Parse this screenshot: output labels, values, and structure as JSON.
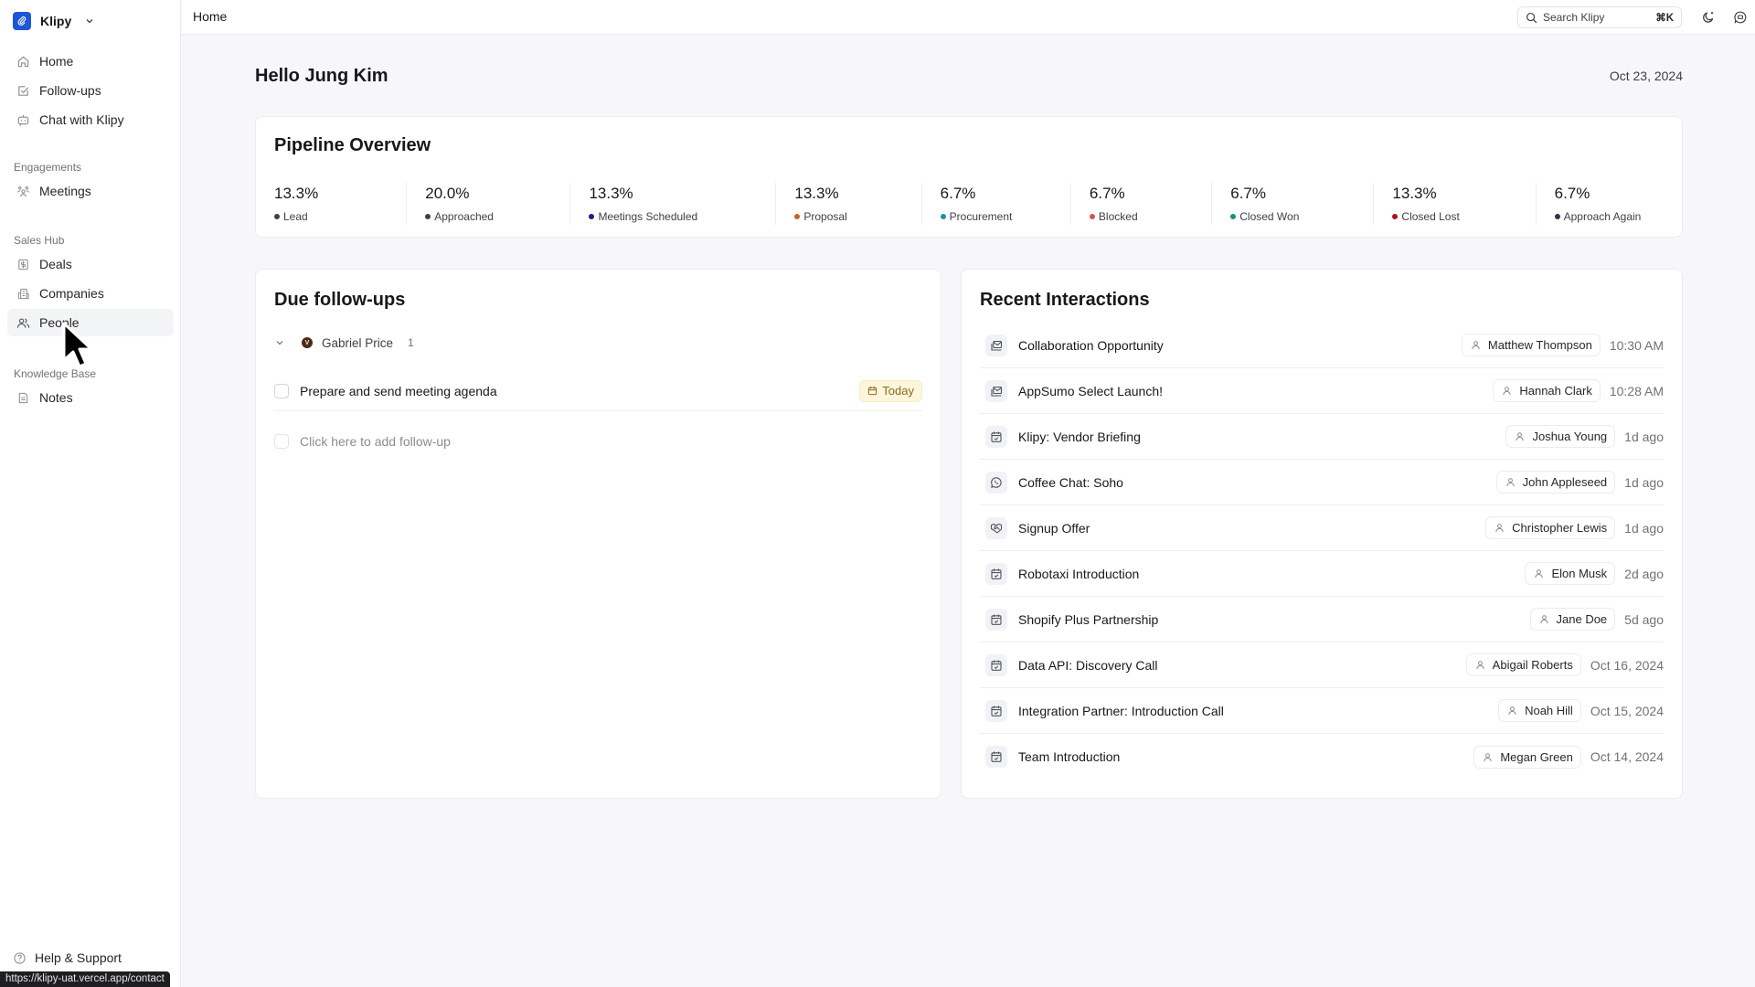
{
  "sidebar": {
    "brand": "Klipy",
    "top_items": [
      {
        "label": "Home",
        "icon": "home-icon"
      },
      {
        "label": "Follow-ups",
        "icon": "checkbox-icon"
      },
      {
        "label": "Chat with Klipy",
        "icon": "bot-icon"
      }
    ],
    "sections": [
      {
        "label": "Engagements",
        "items": [
          {
            "label": "Meetings",
            "icon": "users-group-icon"
          }
        ]
      },
      {
        "label": "Sales Hub",
        "items": [
          {
            "label": "Deals",
            "icon": "dollar-icon"
          },
          {
            "label": "Companies",
            "icon": "building-icon"
          },
          {
            "label": "People",
            "icon": "people-icon",
            "active": true
          }
        ]
      },
      {
        "label": "Knowledge Base",
        "items": [
          {
            "label": "Notes",
            "icon": "note-icon"
          }
        ]
      }
    ],
    "help": "Help & Support"
  },
  "status_url": "https://klipy-uat.vercel.app/contact",
  "topbar": {
    "title": "Home",
    "search_placeholder": "Search Klipy",
    "search_shortcut": "⌘K"
  },
  "main": {
    "greeting": "Hello Jung Kim",
    "date": "Oct 23, 2024",
    "pipeline": {
      "title": "Pipeline Overview",
      "stages": [
        {
          "pct": "13.3%",
          "label": "Lead",
          "color": "#3f3f46"
        },
        {
          "pct": "20.0%",
          "label": "Approached",
          "color": "#3f3f46"
        },
        {
          "pct": "13.3%",
          "label": "Meetings Scheduled",
          "color": "#1e1b8a"
        },
        {
          "pct": "13.3%",
          "label": "Proposal",
          "color": "#c2661f"
        },
        {
          "pct": "6.7%",
          "label": "Procurement",
          "color": "#1a8fa6"
        },
        {
          "pct": "6.7%",
          "label": "Blocked",
          "color": "#d0574b"
        },
        {
          "pct": "6.7%",
          "label": "Closed Won",
          "color": "#17936b"
        },
        {
          "pct": "13.3%",
          "label": "Closed Lost",
          "color": "#b0121f"
        },
        {
          "pct": "6.7%",
          "label": "Approach Again",
          "color": "#2f3447"
        }
      ]
    },
    "followups": {
      "title": "Due follow-ups",
      "group": {
        "name": "Gabriel Price",
        "count": "1",
        "initial": "V"
      },
      "tasks": [
        {
          "text": "Prepare and send meeting agenda",
          "due": "Today"
        }
      ],
      "add_placeholder": "Click here to add follow-up"
    },
    "recent": {
      "title": "Recent Interactions",
      "items": [
        {
          "title": "Collaboration Opportunity",
          "type": "email",
          "person": "Matthew Thompson",
          "time": "10:30 AM"
        },
        {
          "title": "AppSumo Select Launch!",
          "type": "email",
          "person": "Hannah Clark",
          "time": "10:28 AM"
        },
        {
          "title": "Klipy: Vendor Briefing",
          "type": "meeting",
          "person": "Joshua Young",
          "time": "1d ago"
        },
        {
          "title": "Coffee Chat: Soho",
          "type": "whatsapp",
          "person": "John Appleseed",
          "time": "1d ago"
        },
        {
          "title": "Signup Offer",
          "type": "handshake",
          "person": "Christopher Lewis",
          "time": "1d ago"
        },
        {
          "title": "Robotaxi Introduction",
          "type": "meeting",
          "person": "Elon Musk",
          "time": "2d ago"
        },
        {
          "title": "Shopify Plus Partnership",
          "type": "meeting",
          "person": "Jane Doe",
          "time": "5d ago"
        },
        {
          "title": "Data API: Discovery Call",
          "type": "meeting",
          "person": "Abigail Roberts",
          "time": "Oct 16, 2024"
        },
        {
          "title": "Integration Partner: Introduction Call",
          "type": "meeting",
          "person": "Noah Hill",
          "time": "Oct 15, 2024"
        },
        {
          "title": "Team Introduction",
          "type": "meeting",
          "person": "Megan Green",
          "time": "Oct 14, 2024"
        }
      ]
    }
  }
}
